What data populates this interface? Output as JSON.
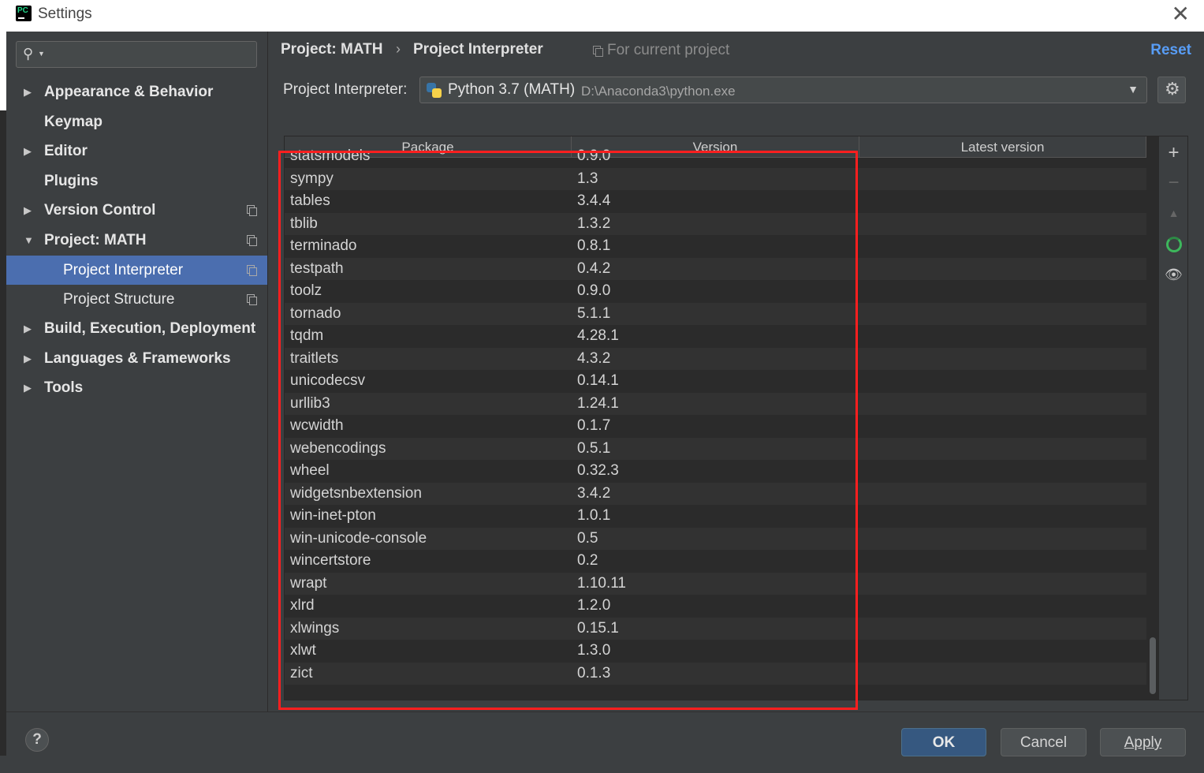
{
  "window": {
    "title": "Settings"
  },
  "sidebar": {
    "search": {
      "value": "",
      "placeholder": ""
    },
    "items": [
      {
        "label": "Appearance & Behavior",
        "expandable": true
      },
      {
        "label": "Keymap",
        "expandable": false
      },
      {
        "label": "Editor",
        "expandable": true
      },
      {
        "label": "Plugins",
        "expandable": false
      },
      {
        "label": "Version Control",
        "expandable": true
      },
      {
        "label": "Project: MATH",
        "expandable": true,
        "expanded": true
      },
      {
        "label": "Project Interpreter",
        "selected": true
      },
      {
        "label": "Project Structure"
      },
      {
        "label": "Build, Execution, Deployment",
        "expandable": true
      },
      {
        "label": "Languages & Frameworks",
        "expandable": true
      },
      {
        "label": "Tools",
        "expandable": true
      }
    ]
  },
  "header": {
    "breadcrumb_parent": "Project: MATH",
    "breadcrumb_separator": "›",
    "breadcrumb_current": "Project Interpreter",
    "scope": "For current project",
    "reset": "Reset"
  },
  "interpreter": {
    "label": "Project Interpreter:",
    "name": "Python 3.7 (MATH)",
    "path": "D:\\Anaconda3\\python.exe"
  },
  "packages": {
    "columns": [
      "Package",
      "Version",
      "Latest version"
    ],
    "rows": [
      {
        "name": "statsmodels",
        "version": "0.9.0",
        "latest": ""
      },
      {
        "name": "sympy",
        "version": "1.3",
        "latest": ""
      },
      {
        "name": "tables",
        "version": "3.4.4",
        "latest": ""
      },
      {
        "name": "tblib",
        "version": "1.3.2",
        "latest": ""
      },
      {
        "name": "terminado",
        "version": "0.8.1",
        "latest": ""
      },
      {
        "name": "testpath",
        "version": "0.4.2",
        "latest": ""
      },
      {
        "name": "toolz",
        "version": "0.9.0",
        "latest": ""
      },
      {
        "name": "tornado",
        "version": "5.1.1",
        "latest": ""
      },
      {
        "name": "tqdm",
        "version": "4.28.1",
        "latest": ""
      },
      {
        "name": "traitlets",
        "version": "4.3.2",
        "latest": ""
      },
      {
        "name": "unicodecsv",
        "version": "0.14.1",
        "latest": ""
      },
      {
        "name": "urllib3",
        "version": "1.24.1",
        "latest": ""
      },
      {
        "name": "wcwidth",
        "version": "0.1.7",
        "latest": ""
      },
      {
        "name": "webencodings",
        "version": "0.5.1",
        "latest": ""
      },
      {
        "name": "wheel",
        "version": "0.32.3",
        "latest": ""
      },
      {
        "name": "widgetsnbextension",
        "version": "3.4.2",
        "latest": ""
      },
      {
        "name": "win-inet-pton",
        "version": "1.0.1",
        "latest": ""
      },
      {
        "name": "win-unicode-console",
        "version": "0.5",
        "latest": ""
      },
      {
        "name": "wincertstore",
        "version": "0.2",
        "latest": ""
      },
      {
        "name": "wrapt",
        "version": "1.10.11",
        "latest": ""
      },
      {
        "name": "xlrd",
        "version": "1.2.0",
        "latest": ""
      },
      {
        "name": "xlwings",
        "version": "0.15.1",
        "latest": ""
      },
      {
        "name": "xlwt",
        "version": "1.3.0",
        "latest": ""
      },
      {
        "name": "zict",
        "version": "0.1.3",
        "latest": ""
      }
    ]
  },
  "toolbar_icons": [
    "add-icon",
    "remove-icon",
    "upgrade-icon",
    "refresh-icon",
    "show-early-releases-icon"
  ],
  "footer": {
    "help": "?",
    "ok": "OK",
    "cancel": "Cancel",
    "apply": "Apply"
  },
  "colors": {
    "selection": "#4b6eaf",
    "link": "#589df6",
    "annotation_box": "#ff1f1f"
  }
}
